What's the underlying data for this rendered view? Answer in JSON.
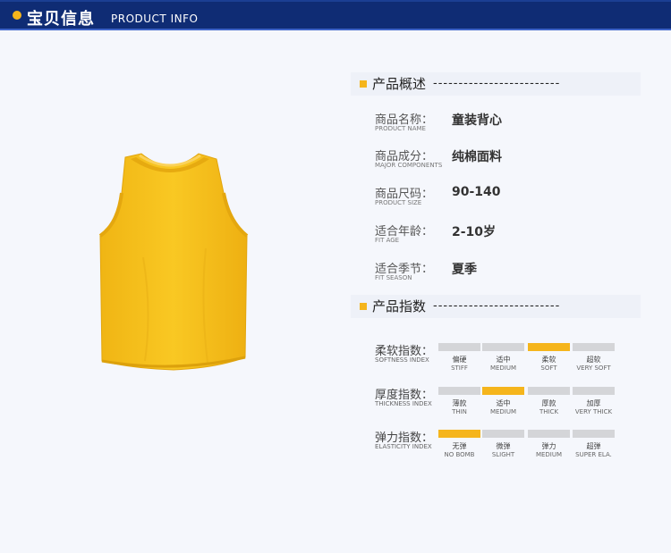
{
  "header": {
    "title_cn": "宝贝信息",
    "title_en": "PRODUCT INFO"
  },
  "overview": {
    "title": "产品概述",
    "dashes": "-------------------------",
    "specs": [
      {
        "label": "商品名称：",
        "sub": "PRODUCT NAME",
        "value": "童装背心"
      },
      {
        "label": "商品成分：",
        "sub": "MAJOR COMPONENTS",
        "value": "纯棉面料"
      },
      {
        "label": "商品尺码：",
        "sub": "PRODUCT SIZE",
        "value": "90-140"
      },
      {
        "label": "适合年龄：",
        "sub": "FIT AGE",
        "value": "2-10岁"
      },
      {
        "label": "适合季节：",
        "sub": "FIT SEASON",
        "value": "夏季"
      }
    ]
  },
  "indices": {
    "title": "产品指数",
    "dashes": "-------------------------",
    "rows": [
      {
        "label": "柔软指数：",
        "sub": "SOFTNESS INDEX",
        "selected": 2,
        "options": [
          {
            "cn": "偏硬",
            "en": "STIFF"
          },
          {
            "cn": "适中",
            "en": "MEDIUM"
          },
          {
            "cn": "柔软",
            "en": "SOFT"
          },
          {
            "cn": "超软",
            "en": "VERY SOFT"
          }
        ]
      },
      {
        "label": "厚度指数：",
        "sub": "THICKNESS INDEX",
        "selected": 1,
        "options": [
          {
            "cn": "薄款",
            "en": "THIN"
          },
          {
            "cn": "适中",
            "en": "MEDIUM"
          },
          {
            "cn": "厚款",
            "en": "THICK"
          },
          {
            "cn": "加厚",
            "en": "VERY THICK"
          }
        ]
      },
      {
        "label": "弹力指数：",
        "sub": "ELASTICITY INDEX",
        "selected": 0,
        "options": [
          {
            "cn": "无弹",
            "en": "NO BOMB"
          },
          {
            "cn": "微弹",
            "en": "SLIGHT"
          },
          {
            "cn": "弹力",
            "en": "MEDIUM"
          },
          {
            "cn": "超弹",
            "en": "SUPER ELA."
          }
        ]
      }
    ]
  },
  "colors": {
    "header_bg": "#0f2c74",
    "accent": "#f5b51c",
    "inactive_bar": "#d4d5d8",
    "product": "#f7c21f"
  },
  "product_image": {
    "icon": "yellow-tank-top"
  }
}
